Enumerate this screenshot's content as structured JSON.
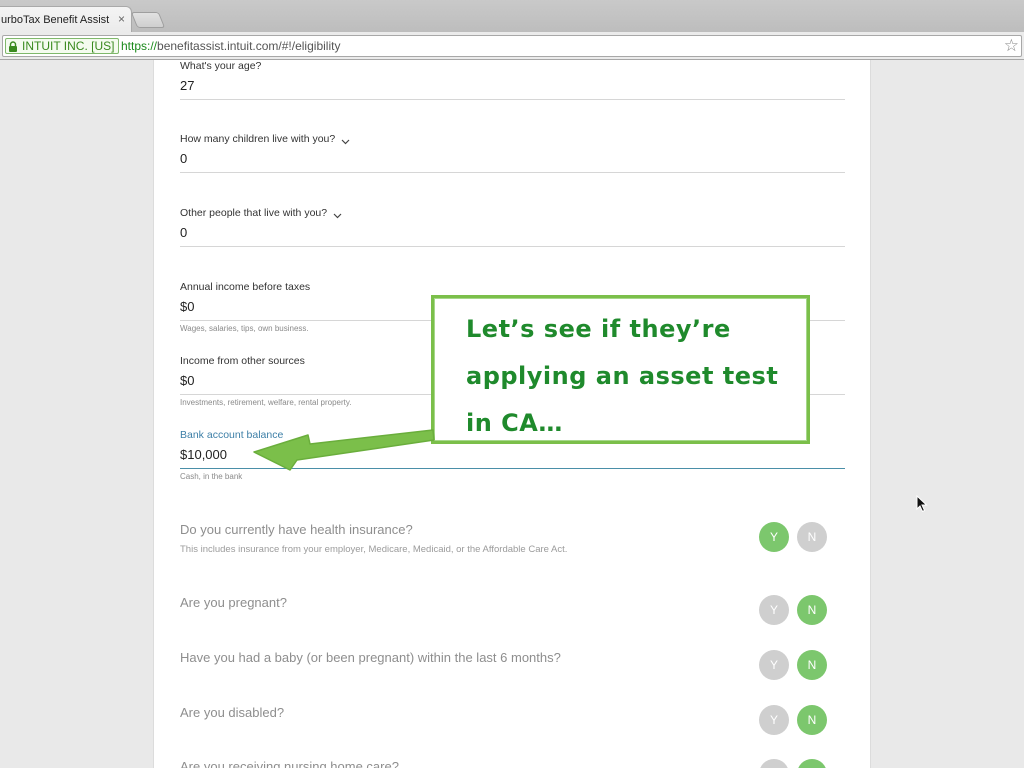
{
  "browser": {
    "tab_title": "urboTax Benefit Assist",
    "tab_close": "×",
    "ev_label": "INTUIT INC. [US]",
    "url_protocol": "https://",
    "url_rest": "benefitassist.intuit.com/#!/eligibility"
  },
  "fields": {
    "age": {
      "label": "What's your age?",
      "value": "27"
    },
    "children": {
      "label": "How many children live with you?",
      "value": "0"
    },
    "others": {
      "label": "Other people that live with you?",
      "value": "0"
    },
    "income": {
      "label": "Annual income before taxes",
      "prefix": "$",
      "value": "0",
      "hint": "Wages, salaries, tips, own business."
    },
    "other_income": {
      "label": "Income from other sources",
      "prefix": "$",
      "value": "0",
      "hint": "Investments, retirement, welfare, rental property."
    },
    "bank": {
      "label": "Bank account balance",
      "prefix": "$",
      "value": "10,000",
      "hint": "Cash, in the bank"
    }
  },
  "questions": [
    {
      "text": "Do you currently have health insurance?",
      "sub": "This includes insurance from your employer, Medicare, Medicaid, or the Affordable Care Act.",
      "selected": "Y"
    },
    {
      "text": "Are you pregnant?",
      "selected": "N"
    },
    {
      "text": "Have you had a baby (or been pregnant) within the last 6 months?",
      "selected": "N"
    },
    {
      "text": "Are you disabled?",
      "selected": "N"
    },
    {
      "text": "Are you receiving nursing home care?",
      "selected": "N"
    }
  ],
  "yes_label": "Y",
  "no_label": "N",
  "annotation": {
    "text": "Let’s see if they’re applying an asset test in CA…",
    "color": "#1f8a2c",
    "border_color": "#7bbf4a"
  },
  "colors": {
    "accent_green": "#7cc76d",
    "inactive_gray": "#cfcfcf",
    "active_field": "#4a8fa8"
  }
}
